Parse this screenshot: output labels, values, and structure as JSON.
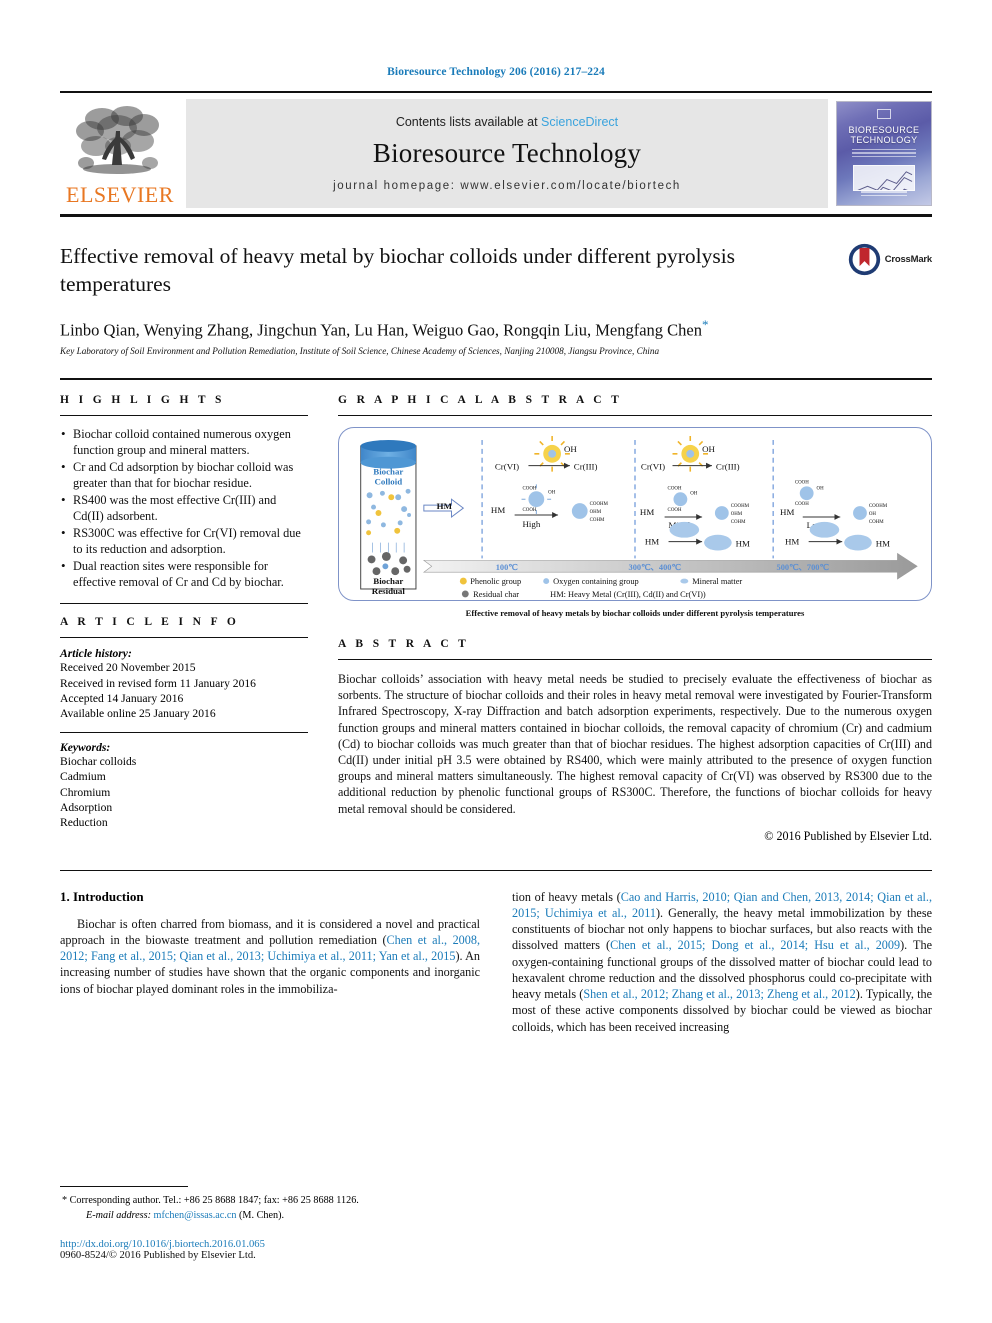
{
  "running_head": "Bioresource Technology 206 (2016) 217–224",
  "masthead": {
    "publisher": "ELSEVIER",
    "contents_prefix": "Contents lists available at ",
    "contents_link": "ScienceDirect",
    "journal_name": "Bioresource Technology",
    "homepage": "journal homepage: www.elsevier.com/locate/biortech",
    "cover_title_line1": "BIORESOURCE",
    "cover_title_line2": "TECHNOLOGY"
  },
  "article": {
    "title": "Effective removal of heavy metal by biochar colloids under different pyrolysis temperatures",
    "authors": "Linbo Qian, Wenying Zhang, Jingchun Yan, Lu Han, Weiguo Gao, Rongqin Liu, Mengfang Chen",
    "author_star": "*",
    "affiliation": "Key Laboratory of Soil Environment and Pollution Remediation, Institute of Soil Science, Chinese Academy of Sciences, Nanjing 210008, Jiangsu Province, China",
    "crossmark_label": "CrossMark"
  },
  "highlights": {
    "heading": "H I G H L I G H T S",
    "items": [
      "Biochar colloid contained numerous oxygen function group and mineral matters.",
      "Cr and Cd adsorption by biochar colloid was greater than that for biochar residue.",
      "RS400 was the most effective Cr(III) and Cd(II) adsorbent.",
      "RS300C was effective for Cr(VI) removal due to its reduction and adsorption.",
      "Dual reaction sites were responsible for effective removal of Cr and Cd by biochar."
    ]
  },
  "article_info": {
    "heading": "A R T I C L E    I N F O",
    "history_label": "Article history:",
    "history": [
      "Received 20 November 2015",
      "Received in revised form 11 January 2016",
      "Accepted 14 January 2016",
      "Available online 25 January 2016"
    ],
    "keywords_label": "Keywords:",
    "keywords": [
      "Biochar colloids",
      "Cadmium",
      "Chromium",
      "Adsorption",
      "Reduction"
    ]
  },
  "graphical_abstract": {
    "heading": "G R A P H I C A L   A B S T R A C T",
    "caption": "Effective removal of heavy metals by biochar colloids under different pyrolysis temperatures",
    "cylinder_top_label_1": "Biochar",
    "cylinder_top_label_2": "Colloid",
    "cylinder_bottom_label_1": "Biochar",
    "cylinder_bottom_label_2": "Residual",
    "hm_arrow_label": "HM",
    "panels": [
      {
        "redox_from": "Cr(VI)",
        "redox_to": "Cr(III)",
        "oh": "OH",
        "hm": "HM",
        "level": "High",
        "temp": "100℃"
      },
      {
        "redox_from": "Cr(VI)",
        "redox_to": "Cr(III)",
        "oh": "OH",
        "hm": "HM",
        "level": "Middle",
        "temp": "300℃、400℃"
      },
      {
        "redox_from": "",
        "redox_to": "",
        "oh": "",
        "hm": "HM",
        "level": "Low",
        "temp": "500℃、700℃"
      }
    ],
    "mineral_rows": [
      {
        "left": "HM",
        "right": "HM"
      },
      {
        "left": "HM",
        "right": "HM"
      }
    ],
    "legend": [
      "Phenolic group",
      "Oxygen containing group",
      "Mineral matter",
      "Residual char",
      "HM: Heavy Metal (Cr(III), Cd(II) and Cr(VI))"
    ]
  },
  "abstract": {
    "heading": "A B S T R A C T",
    "text": "Biochar colloids’ association with heavy metal needs be studied to precisely evaluate the effectiveness of biochar as sorbents. The structure of biochar colloids and their roles in heavy metal removal were investigated by Fourier-Transform Infrared Spectroscopy, X-ray Diffraction and batch adsorption experiments, respectively. Due to the numerous oxygen function groups and mineral matters contained in biochar colloids, the removal capacity of chromium (Cr) and cadmium (Cd) to biochar colloids was much greater than that of biochar residues. The highest adsorption capacities of Cr(III) and Cd(II) under initial pH 3.5 were obtained by RS400, which were mainly attributed to the presence of oxygen function groups and mineral matters simultaneously. The highest removal capacity of Cr(VI) was observed by RS300 due to the additional reduction by phenolic functional groups of RS300C. Therefore, the functions of biochar colloids for heavy metal removal should be considered.",
    "copyright": "© 2016 Published by Elsevier Ltd."
  },
  "introduction": {
    "heading": "1. Introduction",
    "left_parts": [
      "Biochar is often charred from biomass, and it is considered a novel and practical approach in the biowaste treatment and pollution remediation (",
      "Chen et al., 2008, 2012; Fang et al., 2015; Qian et al., 2013; Uchimiya et al., 2011; Yan et al., 2015",
      "). An increasing number of studies have shown that the organic components and inorganic ions of biochar played dominant roles in the immobiliza-"
    ],
    "right_parts": [
      "tion of heavy metals (",
      "Cao and Harris, 2010; Qian and Chen, 2013, 2014; Qian et al., 2015; Uchimiya et al., 2011",
      "). Generally, the heavy metal immobilization by these constituents of biochar not only happens to biochar surfaces, but also reacts with the dissolved matters (",
      "Chen et al., 2015; Dong et al., 2014; Hsu et al., 2009",
      "). The oxygen-containing functional groups of the dissolved matter of biochar could lead to hexavalent chrome reduction and the dissolved phosphorus could co-precipitate with heavy metals (",
      "Shen et al., 2012; Zhang et al., 2013; Zheng et al., 2012",
      "). Typically, the most of these active components dissolved by biochar could be viewed as biochar colloids, which has been received increasing"
    ]
  },
  "footnote": {
    "star": "*",
    "corresponding": "Corresponding author. Tel.: +86 25 8688 1847; fax: +86 25 8688 1126.",
    "email_label": "E-mail address:",
    "email": "mfchen@issas.ac.cn",
    "email_suffix": "(M. Chen).",
    "doi": "http://dx.doi.org/10.1016/j.biortech.2016.01.065",
    "issn": "0960-8524/© 2016 Published by Elsevier Ltd."
  },
  "colors": {
    "link_blue": "#1a7bb9",
    "elsevier_orange": "#E87722",
    "band_gray": "#e6e6e6",
    "ga_border": "#7f93c8"
  }
}
